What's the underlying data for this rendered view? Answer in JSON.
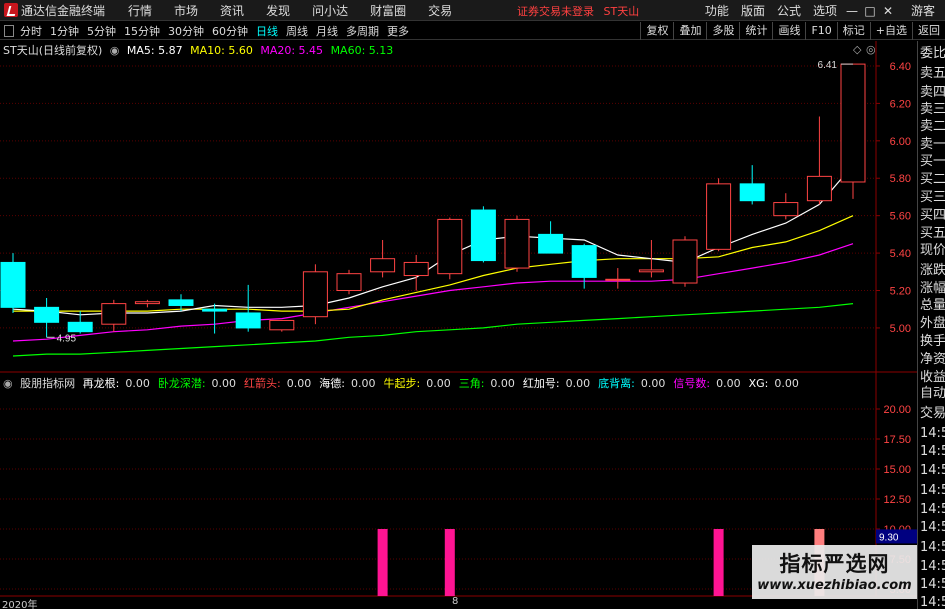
{
  "menubar": {
    "app_title": "通达信金融终端",
    "items": [
      "行情",
      "市场",
      "资讯",
      "发现",
      "问小达",
      "财富圈",
      "交易"
    ],
    "status_notice": "证券交易未登录",
    "stock_name": "ST天山",
    "right_items": [
      "功能",
      "版面",
      "公式",
      "选项"
    ],
    "win_min": "—",
    "win_max": "□",
    "win_close": "✕",
    "guest": "游客"
  },
  "toolbar": {
    "periods": [
      "分时",
      "1分钟",
      "5分钟",
      "15分钟",
      "30分钟",
      "60分钟",
      "日线",
      "周线",
      "月线",
      "多周期",
      "更多"
    ],
    "active_period": "日线",
    "buttons": [
      "复权",
      "叠加",
      "多股",
      "统计",
      "画线",
      "F10",
      "标记",
      "+自选",
      "返回"
    ]
  },
  "main_legend": {
    "title": "ST天山(日线前复权)",
    "ma5": "MA5: 5.87",
    "ma10": "MA10: 5.60",
    "ma20": "MA20: 5.45",
    "ma60": "MA60: 5.13"
  },
  "indicator_legend": {
    "name": "股朋指标网",
    "items": [
      {
        "label": "再龙根:",
        "value": "0.00",
        "color": "#ffffff"
      },
      {
        "label": "卧龙深潜:",
        "value": "0.00",
        "color": "#00ff00"
      },
      {
        "label": "红箭头:",
        "value": "0.00",
        "color": "#ff4444"
      },
      {
        "label": "海德:",
        "value": "0.00",
        "color": "#ffffff"
      },
      {
        "label": "牛起步:",
        "value": "0.00",
        "color": "#ffff00"
      },
      {
        "label": "三角:",
        "value": "0.00",
        "color": "#00ff00"
      },
      {
        "label": "红加号:",
        "value": "0.00",
        "color": "#ffffff"
      },
      {
        "label": "底背离:",
        "value": "0.00",
        "color": "#00ffff"
      },
      {
        "label": "信号数:",
        "value": "0.00",
        "color": "#ff00ff"
      },
      {
        "label": "XG:",
        "value": "0.00",
        "color": "#ffffff"
      }
    ]
  },
  "annotations": {
    "high_label": "6.41",
    "low_label": "4.95",
    "indicator_marker": "9.30"
  },
  "date_axis": {
    "year": "2020年",
    "month": "8"
  },
  "sidebar": {
    "items": [
      "委比",
      "卖五",
      "卖四",
      "卖三",
      "卖二",
      "卖一",
      "买一",
      "买二",
      "买三",
      "买四",
      "买五",
      "现价",
      "涨跌",
      "涨幅",
      "总量",
      "外盘",
      "换手",
      "净资",
      "收益",
      "自动",
      "交易",
      "14:55",
      "14:55",
      "14:55",
      "14:55",
      "14:55",
      "14:56",
      "14:56",
      "14:56",
      "14:56",
      "14:56"
    ]
  },
  "watermark": {
    "title": "指标严选网",
    "url": "www.xuezhibiao.com"
  },
  "colors": {
    "up": "#ff4444",
    "down": "#00ffff",
    "ma5": "#ffffff",
    "ma10": "#ffff00",
    "ma20": "#ff00ff",
    "ma60": "#00ff00",
    "signal_bar": "#ff1493"
  },
  "chart_data": [
    {
      "type": "candlestick",
      "ylim": [
        4.85,
        6.48
      ],
      "yticks": [
        5.0,
        5.2,
        5.4,
        5.6,
        5.8,
        6.0,
        6.2,
        6.4
      ],
      "candles": [
        {
          "open": 5.35,
          "high": 5.4,
          "low": 5.08,
          "close": 5.11
        },
        {
          "open": 5.11,
          "high": 5.16,
          "low": 4.95,
          "close": 5.03
        },
        {
          "open": 5.03,
          "high": 5.09,
          "low": 4.97,
          "close": 4.98
        },
        {
          "open": 5.02,
          "high": 5.15,
          "low": 4.98,
          "close": 5.13
        },
        {
          "open": 5.13,
          "high": 5.15,
          "low": 5.11,
          "close": 5.14
        },
        {
          "open": 5.15,
          "high": 5.18,
          "low": 5.09,
          "close": 5.12
        },
        {
          "open": 5.1,
          "high": 5.13,
          "low": 4.97,
          "close": 5.09
        },
        {
          "open": 5.08,
          "high": 5.23,
          "low": 4.98,
          "close": 5.0
        },
        {
          "open": 4.99,
          "high": 5.04,
          "low": 4.98,
          "close": 5.04
        },
        {
          "open": 5.06,
          "high": 5.34,
          "low": 5.02,
          "close": 5.3
        },
        {
          "open": 5.2,
          "high": 5.31,
          "low": 5.18,
          "close": 5.29
        },
        {
          "open": 5.3,
          "high": 5.47,
          "low": 5.27,
          "close": 5.37
        },
        {
          "open": 5.28,
          "high": 5.39,
          "low": 5.2,
          "close": 5.35
        },
        {
          "open": 5.29,
          "high": 5.59,
          "low": 5.26,
          "close": 5.58
        },
        {
          "open": 5.63,
          "high": 5.65,
          "low": 5.35,
          "close": 5.36
        },
        {
          "open": 5.32,
          "high": 5.6,
          "low": 5.3,
          "close": 5.58
        },
        {
          "open": 5.5,
          "high": 5.57,
          "low": 5.4,
          "close": 5.4
        },
        {
          "open": 5.44,
          "high": 5.45,
          "low": 5.21,
          "close": 5.27
        },
        {
          "open": 5.26,
          "high": 5.32,
          "low": 5.21,
          "close": 5.26
        },
        {
          "open": 5.3,
          "high": 5.47,
          "low": 5.27,
          "close": 5.31
        },
        {
          "open": 5.24,
          "high": 5.49,
          "low": 5.22,
          "close": 5.47
        },
        {
          "open": 5.42,
          "high": 5.8,
          "low": 5.41,
          "close": 5.77
        },
        {
          "open": 5.77,
          "high": 5.87,
          "low": 5.66,
          "close": 5.68
        },
        {
          "open": 5.6,
          "high": 5.72,
          "low": 5.58,
          "close": 5.67
        },
        {
          "open": 5.68,
          "high": 6.13,
          "low": 5.66,
          "close": 5.81
        },
        {
          "open": 5.78,
          "high": 6.41,
          "low": 5.69,
          "close": 6.41
        }
      ],
      "ma5": [
        5.1,
        5.09,
        5.07,
        5.08,
        5.08,
        5.09,
        5.12,
        5.11,
        5.11,
        5.12,
        5.16,
        5.22,
        5.27,
        5.39,
        5.47,
        5.49,
        5.48,
        5.47,
        5.39,
        5.37,
        5.35,
        5.43,
        5.5,
        5.56,
        5.66,
        5.87
      ],
      "ma10": [
        5.09,
        5.09,
        5.09,
        5.09,
        5.09,
        5.1,
        5.1,
        5.1,
        5.09,
        5.09,
        5.1,
        5.15,
        5.19,
        5.23,
        5.28,
        5.32,
        5.34,
        5.36,
        5.37,
        5.37,
        5.37,
        5.38,
        5.43,
        5.46,
        5.52,
        5.6
      ],
      "ma20": [
        4.93,
        4.94,
        4.96,
        4.98,
        4.99,
        5.01,
        5.02,
        5.04,
        5.05,
        5.08,
        5.11,
        5.14,
        5.17,
        5.2,
        5.22,
        5.24,
        5.25,
        5.25,
        5.25,
        5.25,
        5.26,
        5.29,
        5.32,
        5.35,
        5.39,
        5.45
      ],
      "ma60": [
        4.85,
        4.86,
        4.86,
        4.87,
        4.88,
        4.89,
        4.9,
        4.91,
        4.92,
        4.93,
        4.95,
        4.96,
        4.98,
        4.99,
        5.0,
        5.02,
        5.03,
        5.04,
        5.05,
        5.06,
        5.07,
        5.08,
        5.09,
        5.1,
        5.11,
        5.13
      ]
    },
    {
      "type": "bar",
      "title": "股朋指标网",
      "ylim": [
        4.0,
        22.0
      ],
      "yticks": [
        20.0,
        17.5,
        15.0,
        12.5,
        10.0,
        7.5,
        5.0,
        2.5
      ],
      "signal_bars": [
        {
          "index": 11,
          "value": 10.0,
          "color": "#ff1493"
        },
        {
          "index": 13,
          "value": 10.0,
          "color": "#ff1493"
        },
        {
          "index": 21,
          "value": 10.0,
          "color": "#ff1493"
        },
        {
          "index": 24,
          "value": 10.0,
          "color": "#ff7f7f"
        }
      ]
    }
  ]
}
